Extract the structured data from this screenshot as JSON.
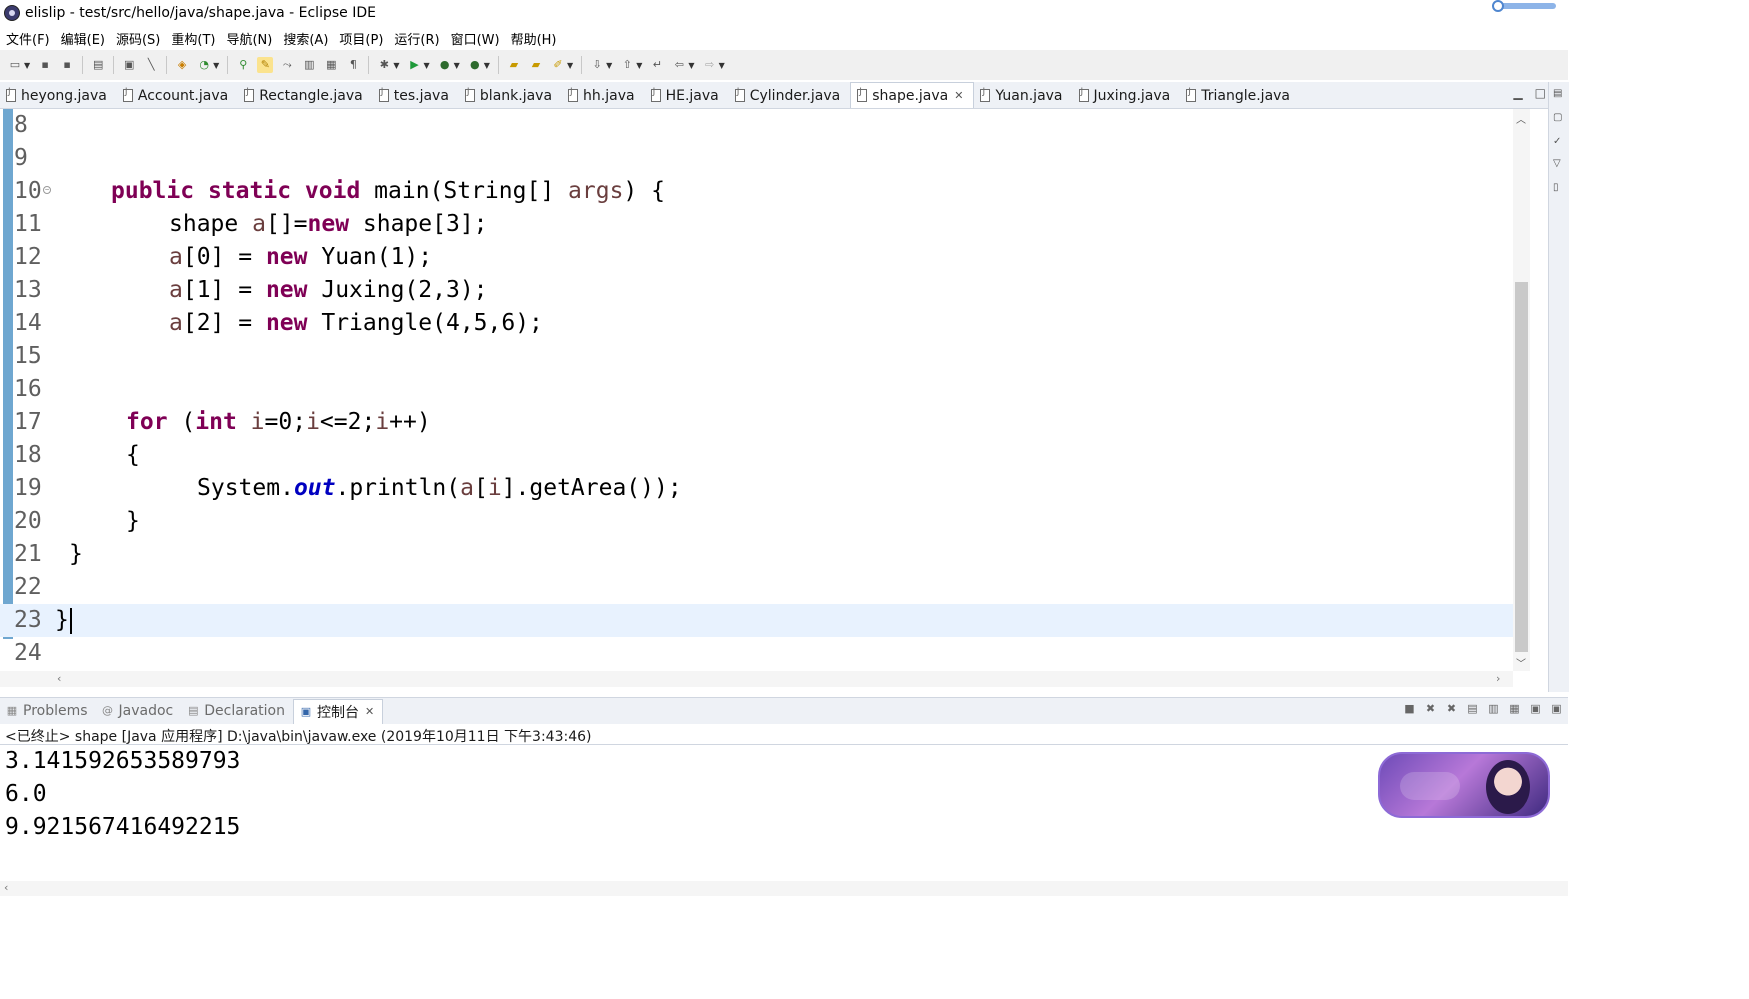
{
  "window": {
    "title": "elislip - test/src/hello/java/shape.java - Eclipse IDE"
  },
  "menu": [
    "文件(F)",
    "编辑(E)",
    "源码(S)",
    "重构(T)",
    "导航(N)",
    "搜索(A)",
    "项目(P)",
    "运行(R)",
    "窗口(W)",
    "帮助(H)"
  ],
  "editor_tabs": [
    "heyong.java",
    "Account.java",
    "Rectangle.java",
    "tes.java",
    "blank.java",
    "hh.java",
    "HE.java",
    "Cylinder.java",
    "shape.java",
    "Yuan.java",
    "Juxing.java",
    "Triangle.java"
  ],
  "active_tab": "shape.java",
  "code": {
    "lines": [
      {
        "no": "8"
      },
      {
        "no": "9"
      },
      {
        "no": "10"
      },
      {
        "no": "11"
      },
      {
        "no": "12"
      },
      {
        "no": "13"
      },
      {
        "no": "14"
      },
      {
        "no": "15"
      },
      {
        "no": "16"
      },
      {
        "no": "17"
      },
      {
        "no": "18"
      },
      {
        "no": "19"
      },
      {
        "no": "20"
      },
      {
        "no": "21"
      },
      {
        "no": "22"
      },
      {
        "no": "23"
      },
      {
        "no": "24"
      }
    ],
    "t10": [
      "public",
      "static",
      "void",
      "main(String[] ",
      "args",
      ") {"
    ],
    "t11": [
      "shape ",
      "a",
      "[]=",
      "new",
      " shape[3];"
    ],
    "t12": [
      "a",
      "[0] = ",
      "new",
      " Yuan(1);"
    ],
    "t13": [
      "a",
      "[1] = ",
      "new",
      " Juxing(2,3);"
    ],
    "t14": [
      "a",
      "[2] = ",
      "new",
      " Triangle(4,5,6);"
    ],
    "t17": [
      "for",
      " (",
      "int",
      " ",
      "i",
      "=0;",
      "i",
      "<=2;",
      "i",
      "++)"
    ],
    "t18": "{",
    "t19": [
      "System.",
      "out",
      ".println(",
      "a",
      "[",
      "i",
      "].getArea());"
    ],
    "t20": "}",
    "t21": "}",
    "t23": "}"
  },
  "bottom_tabs": [
    "Problems",
    "Javadoc",
    "Declaration",
    "控制台"
  ],
  "console": {
    "status": "<已终止> shape [Java 应用程序] D:\\java\\bin\\javaw.exe  (2019年10月11日 下午3:43:46)",
    "output": [
      "3.141592653589793",
      "6.0",
      "9.921567416492215"
    ]
  }
}
